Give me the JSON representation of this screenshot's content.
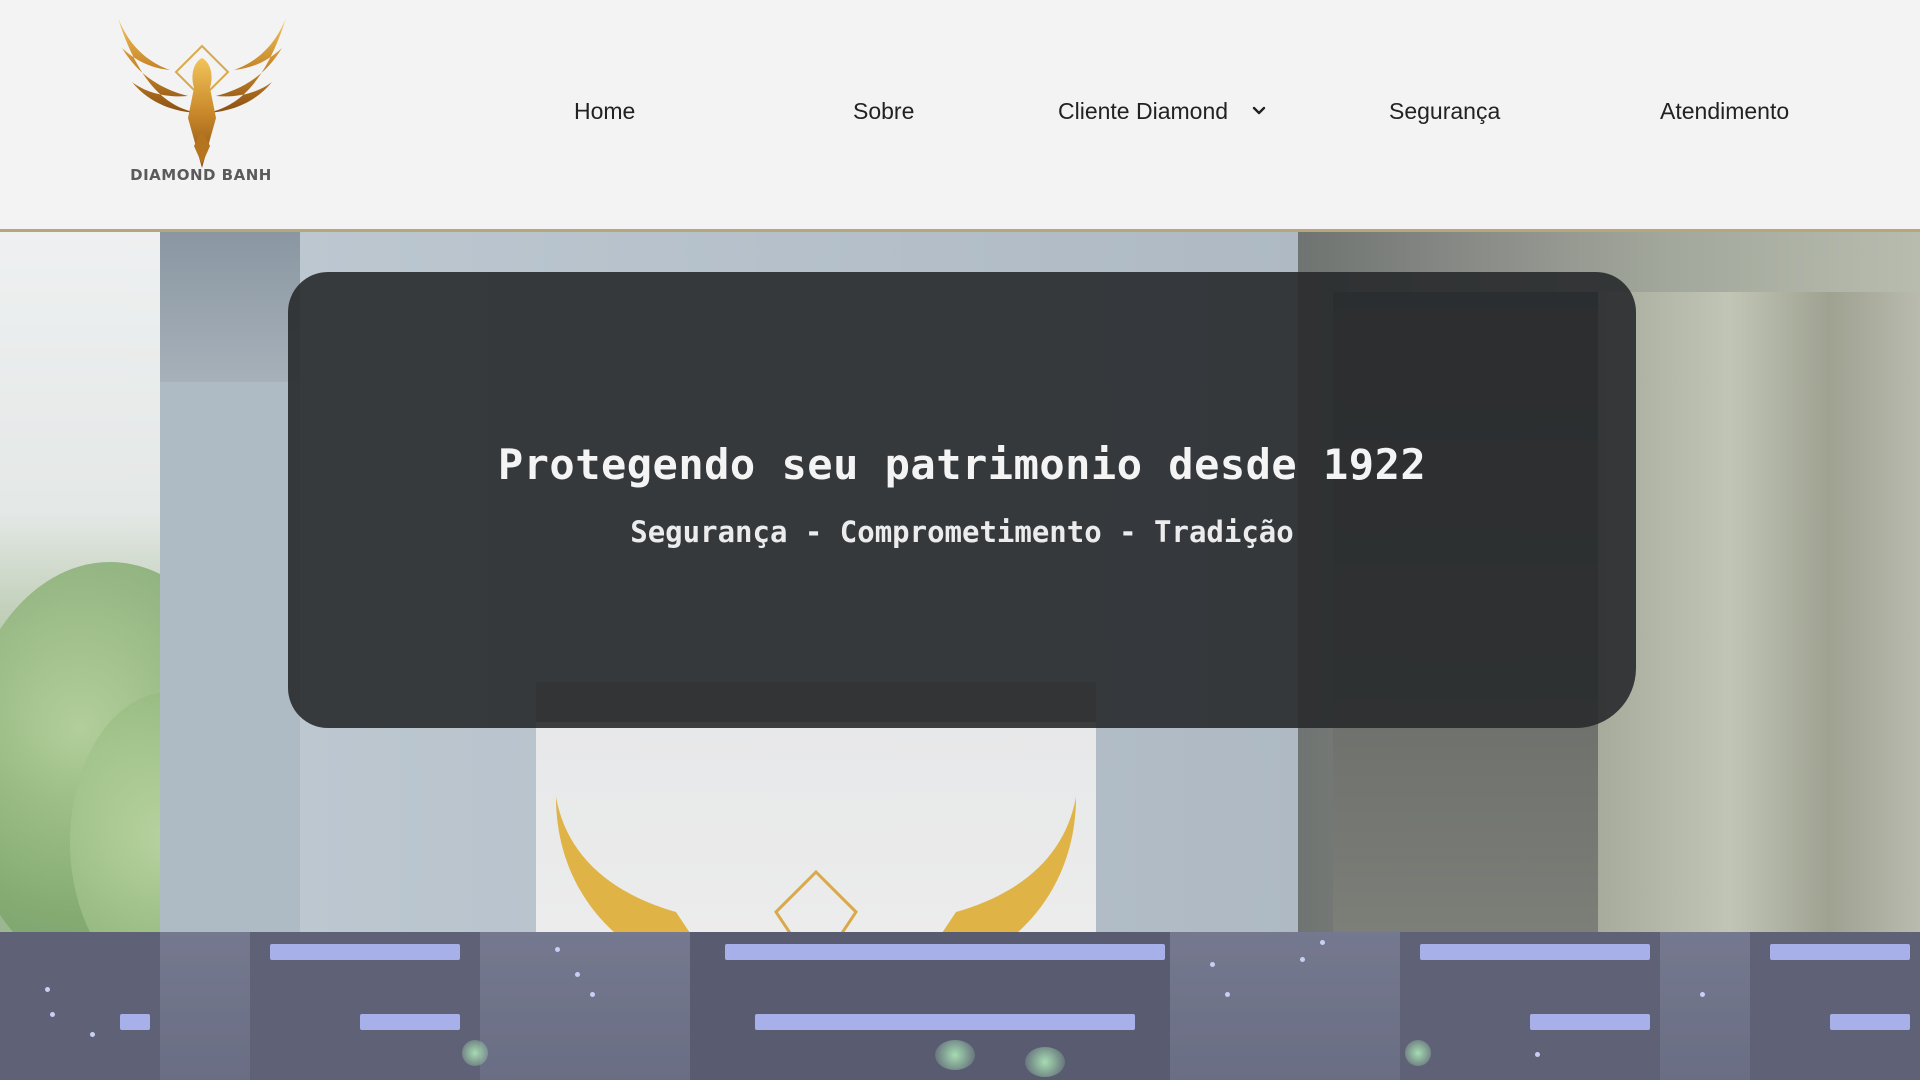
{
  "brand": {
    "name": "DIAMOND BANH",
    "accent_gold": "#c9962a",
    "logo_icon": "eagle-icon"
  },
  "nav": {
    "items": [
      {
        "label": "Home"
      },
      {
        "label": "Sobre"
      },
      {
        "label": "Cliente Diamond",
        "has_dropdown": true,
        "dropdown_icon": "chevron-down-icon"
      },
      {
        "label": "Segurança"
      },
      {
        "label": "Atendimento"
      }
    ]
  },
  "hero": {
    "title": "Protegendo seu patrimonio desde 1922",
    "subtitle": "Segurança - Comprometimento - Tradição"
  }
}
